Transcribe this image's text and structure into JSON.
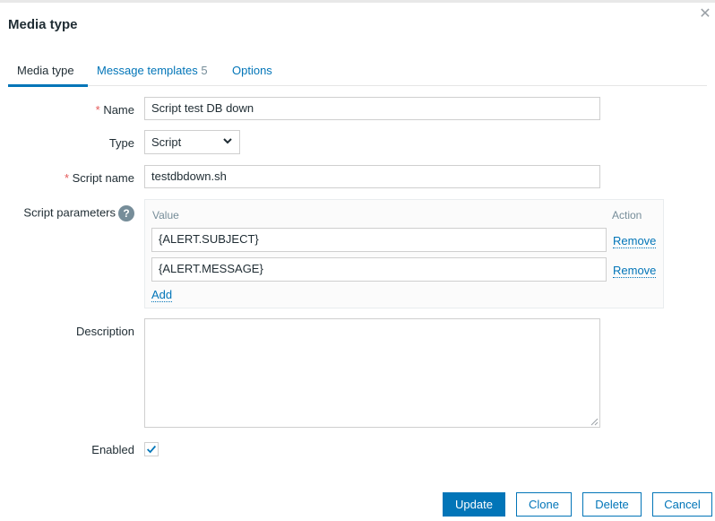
{
  "dialog": {
    "title": "Media type",
    "close_icon": "close-icon"
  },
  "tabs": [
    {
      "label": "Media type",
      "active": true
    },
    {
      "label": "Message templates",
      "count": "5"
    },
    {
      "label": "Options"
    }
  ],
  "form": {
    "required_marker": "*",
    "name": {
      "label": "Name",
      "value": "Script test DB down"
    },
    "type": {
      "label": "Type",
      "value": "Script"
    },
    "script_name": {
      "label": "Script name",
      "value": "testdbdown.sh"
    },
    "script_parameters": {
      "label": "Script parameters",
      "help_icon": "?",
      "value_header": "Value",
      "action_header": "Action",
      "rows": [
        {
          "value": "{ALERT.SUBJECT}",
          "action": "Remove"
        },
        {
          "value": "{ALERT.MESSAGE}",
          "action": "Remove"
        }
      ],
      "add_label": "Add"
    },
    "description": {
      "label": "Description",
      "value": ""
    },
    "enabled": {
      "label": "Enabled",
      "checked": true
    }
  },
  "buttons": {
    "update": "Update",
    "clone": "Clone",
    "delete": "Delete",
    "cancel": "Cancel"
  },
  "colors": {
    "accent": "#0275b8",
    "required": "#e45959",
    "muted": "#768d99"
  }
}
